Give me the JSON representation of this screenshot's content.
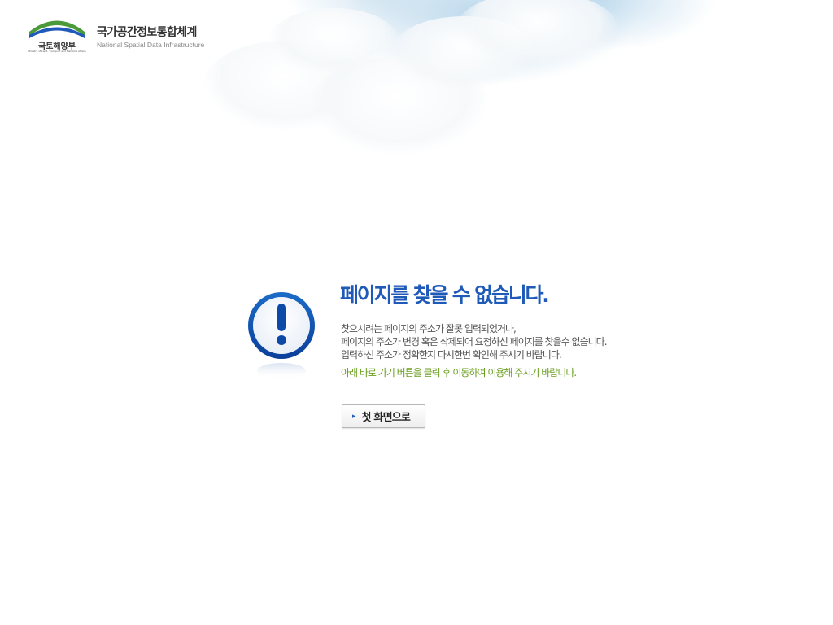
{
  "logo": {
    "emblem_text": "국토해양부",
    "emblem_sub": "Ministry of Land, Transport and Maritime Affairs",
    "title": "국가공간정보통합체계",
    "subtitle": "National Spatial Data Infrastructure"
  },
  "error": {
    "title": "페이지를 찾을 수 없습니다.",
    "messages": [
      "찾으시려는 페이지의 주소가 잘못 입력되었거나,",
      "페이지의 주소가 변경 혹은 삭제되어 요청하신 페이지를 찾을수 없습니다.",
      "입력하신 주소가 정확한지 다시한번 확인해 주시기 바랍니다."
    ],
    "guide": "아래 바로 가기 버튼을 클릭 후 이동하여 이용해 주시기 바랍니다."
  },
  "home_button": {
    "label": "첫 화면으로"
  },
  "icons": {
    "alert": "exclamation-circle-icon",
    "arrow": "chevron-right-icon"
  },
  "colors": {
    "title": "#1f5ab8",
    "guide": "#6a9e1f",
    "emblem_green": "#4a9a3a",
    "emblem_blue": "#1f5ab8"
  }
}
